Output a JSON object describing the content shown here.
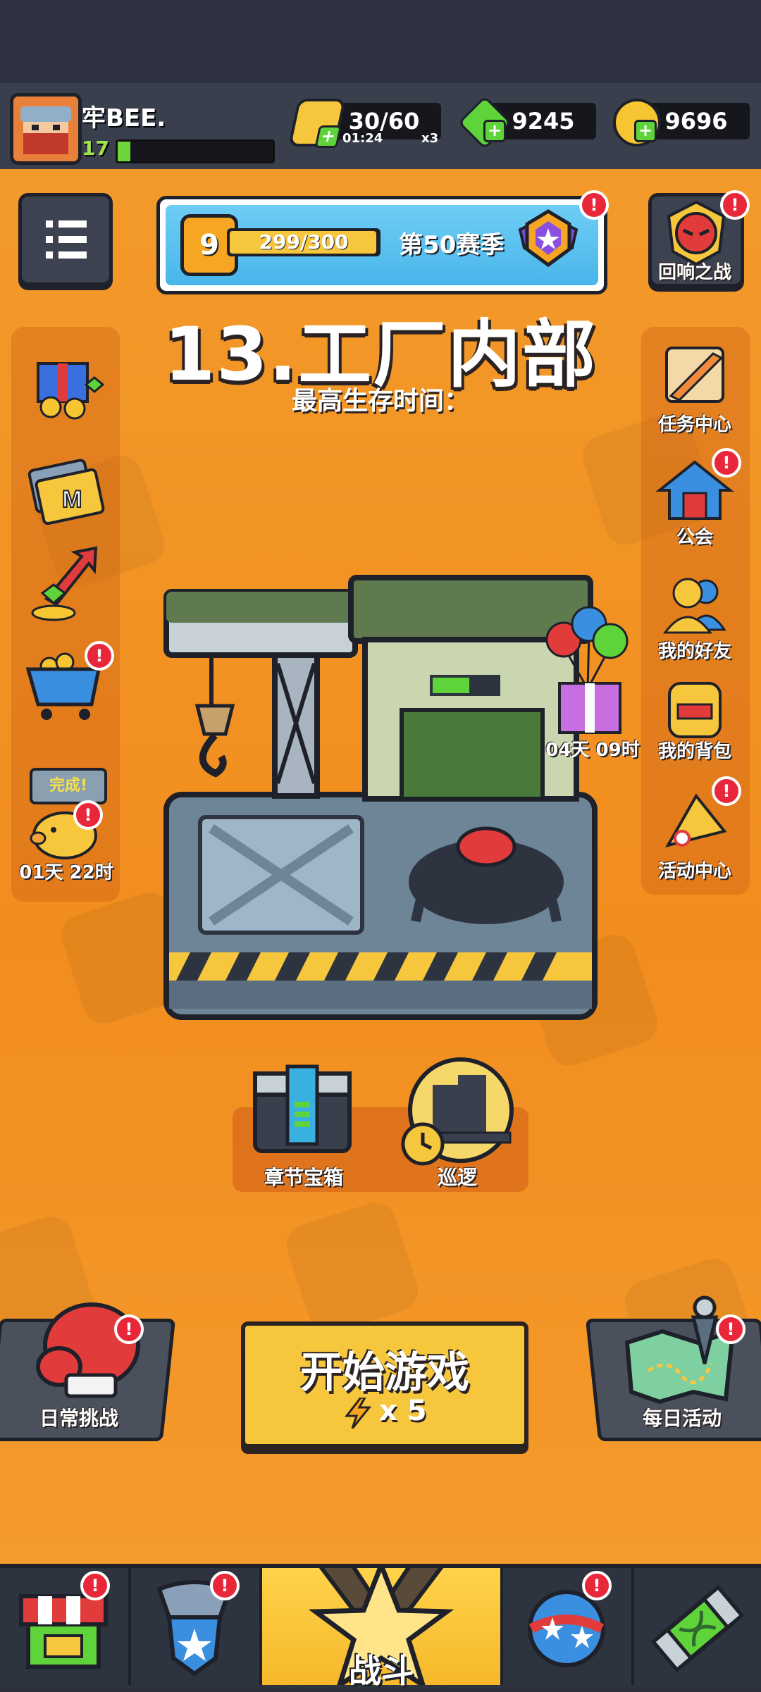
{
  "player": {
    "name": "牢BEE.",
    "level": "17",
    "xp_progress": 0.08
  },
  "resources": {
    "energy": {
      "value": "30/60",
      "timer": "01:24",
      "multiplier": "x3"
    },
    "gems": {
      "value": "9245"
    },
    "coins": {
      "value": "9696"
    }
  },
  "season": {
    "rank": "9",
    "progress": "299/300",
    "progress_fraction": 0.997,
    "label": "第50赛季"
  },
  "stage": {
    "title": "13.工厂内部",
    "subtitle": "最高生存时间："
  },
  "top_right": {
    "label": "回响之战"
  },
  "left_side": {
    "piggy_bubble": "完成!",
    "piggy_timer": "01天 22时"
  },
  "right_side": {
    "items": [
      "任务中心",
      "公会",
      "我的好友",
      "我的背包",
      "活动中心"
    ]
  },
  "gift": {
    "timer": "04天 09时"
  },
  "chapter_chest": {
    "label": "章节宝箱"
  },
  "patrol": {
    "label": "巡逻"
  },
  "daily_challenge": {
    "label": "日常挑战"
  },
  "daily_events": {
    "label": "每日活动"
  },
  "start": {
    "label": "开始游戏",
    "cost": "x 5"
  },
  "nav": {
    "battle_label": "战斗"
  },
  "alert": "!",
  "colors": {
    "accent_orange": "#f18d1e",
    "start_yellow": "#f6c63c",
    "badge_red": "#e8283a"
  }
}
